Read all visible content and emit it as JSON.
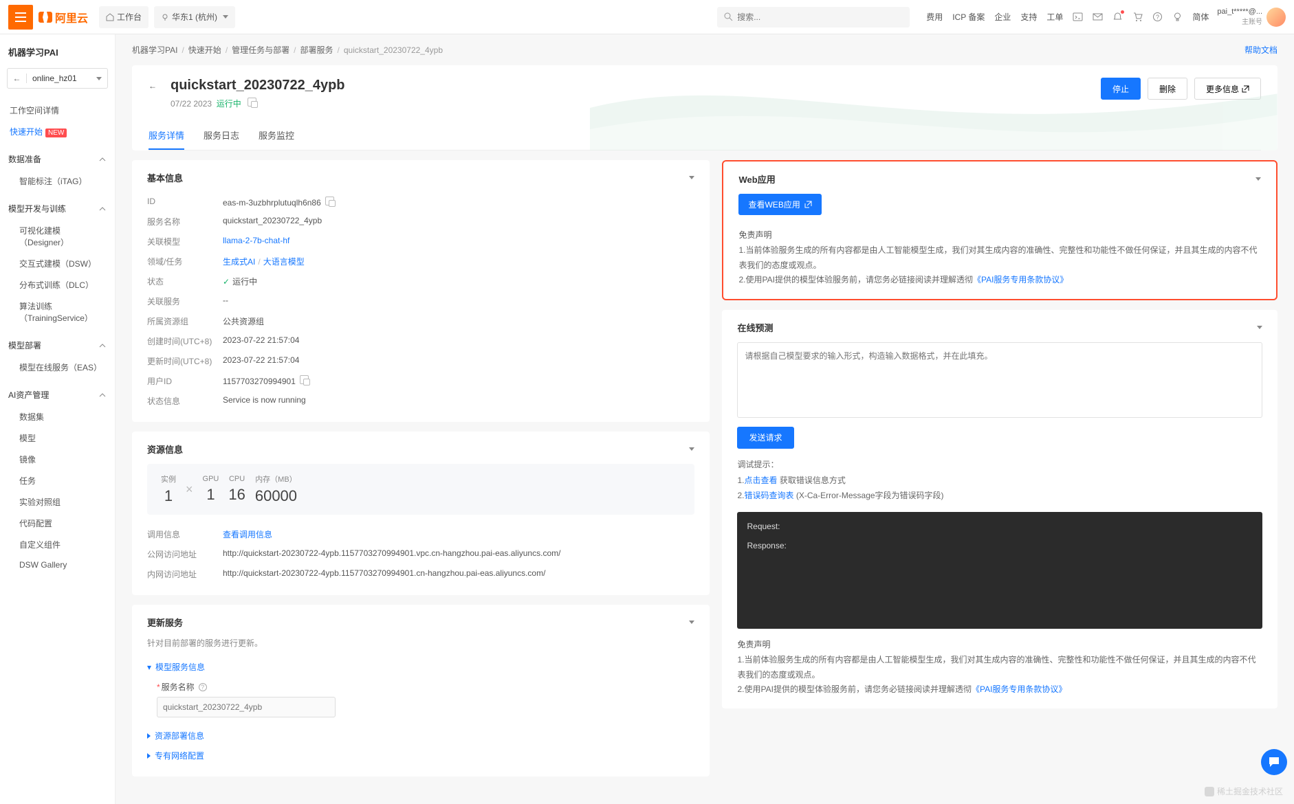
{
  "header": {
    "brand": "阿里云",
    "workspace_btn": "工作台",
    "region": "华东1 (杭州)",
    "search_placeholder": "搜索...",
    "links": [
      "费用",
      "ICP 备案",
      "企业",
      "支持",
      "工单"
    ],
    "lang": "简体",
    "user": "pai_t*****@...",
    "user_sub": "主账号"
  },
  "sidebar": {
    "title": "机器学习PAI",
    "select": "online_hz01",
    "workspace_detail": "工作空间详情",
    "quickstart": "快速开始",
    "quickstart_badge": "NEW",
    "groups": [
      {
        "label": "数据准备",
        "items": [
          "智能标注（iTAG）"
        ]
      },
      {
        "label": "模型开发与训练",
        "items": [
          "可视化建模（Designer）",
          "交互式建模（DSW）",
          "分布式训练（DLC）",
          "算法训练（TrainingService）"
        ]
      },
      {
        "label": "模型部署",
        "items": [
          "模型在线服务（EAS）"
        ]
      },
      {
        "label": "AI资产管理",
        "items": [
          "数据集",
          "模型",
          "镜像",
          "任务",
          "实验对照组",
          "代码配置",
          "自定义组件",
          "DSW Gallery"
        ]
      }
    ]
  },
  "breadcrumb": {
    "items": [
      "机器学习PAI",
      "快速开始",
      "管理任务与部署",
      "部署服务"
    ],
    "current": "quickstart_20230722_4ypb",
    "help": "帮助文档"
  },
  "page": {
    "title": "quickstart_20230722_4ypb",
    "date": "07/22 2023",
    "status": "运行中",
    "actions": {
      "stop": "停止",
      "delete": "删除",
      "more": "更多信息"
    },
    "tabs": [
      "服务详情",
      "服务日志",
      "服务监控"
    ]
  },
  "basic": {
    "heading": "基本信息",
    "rows": {
      "id_k": "ID",
      "id_v": "eas-m-3uzbhrplutuqlh6n86",
      "name_k": "服务名称",
      "name_v": "quickstart_20230722_4ypb",
      "model_k": "关联模型",
      "model_v": "llama-2-7b-chat-hf",
      "domain_k": "领域/任务",
      "domain_a": "生成式AI",
      "domain_b": "大语言模型",
      "state_k": "状态",
      "state_v": "运行中",
      "svc_k": "关联服务",
      "svc_v": "--",
      "resgrp_k": "所属资源组",
      "resgrp_v": "公共资源组",
      "ctime_k": "创建时间(UTC+8)",
      "ctime_v": "2023-07-22 21:57:04",
      "utime_k": "更新时间(UTC+8)",
      "utime_v": "2023-07-22 21:57:04",
      "uid_k": "用户ID",
      "uid_v": "1157703270994901",
      "info_k": "状态信息",
      "info_v": "Service is now running"
    }
  },
  "resource": {
    "heading": "资源信息",
    "inst_l": "实例",
    "inst_v": "1",
    "gpu_l": "GPU",
    "gpu_v": "1",
    "cpu_l": "CPU",
    "cpu_v": "16",
    "mem_l": "内存（MB）",
    "mem_v": "60000",
    "call_k": "调用信息",
    "call_v": "查看调用信息",
    "pub_k": "公网访问地址",
    "pub_v": "http://quickstart-20230722-4ypb.1157703270994901.vpc.cn-hangzhou.pai-eas.aliyuncs.com/",
    "intra_k": "内网访问地址",
    "intra_v": "http://quickstart-20230722-4ypb.1157703270994901.cn-hangzhou.pai-eas.aliyuncs.com/"
  },
  "update": {
    "heading": "更新服务",
    "desc": "针对目前部署的服务进行更新。",
    "sec1": "模型服务信息",
    "svc_name_l": "服务名称",
    "svc_name_ph": "quickstart_20230722_4ypb",
    "sec2": "资源部署信息",
    "sec3": "专有网络配置"
  },
  "webapp": {
    "heading": "Web应用",
    "view_btn": "查看WEB应用",
    "disc_title": "免责声明",
    "d1": "1.当前体验服务生成的所有内容都是由人工智能模型生成，我们对其生成内容的准确性、完整性和功能性不做任何保证，并且其生成的内容不代表我们的态度或观点。",
    "d2_a": "2.使用PAI提供的模型体验服务前，请您务必链接阅读并理解透彻",
    "d2_link": "《PAI服务专用条款协议》"
  },
  "predict": {
    "heading": "在线预测",
    "placeholder": "请根据自己模型要求的输入形式，构造输入数据格式，并在此填充。",
    "send_btn": "发送请求",
    "tips_title": "调试提示：",
    "tip1_a": "1.",
    "tip1_link": "点击查看",
    "tip1_b": " 获取错误信息方式",
    "tip2_a": "2.",
    "tip2_link": "错误码查询表",
    "tip2_b": " (X-Ca-Error-Message字段为错误码字段)",
    "console_req": "Request:",
    "console_res": "Response:",
    "disc2_title": "免责声明",
    "disc2_1": "1.当前体验服务生成的所有内容都是由人工智能模型生成，我们对其生成内容的准确性、完整性和功能性不做任何保证，并且其生成的内容不代表我们的态度或观点。",
    "disc2_2a": "2.使用PAI提供的模型体验服务前，请您务必链接阅读并理解透彻",
    "disc2_2link": "《PAI服务专用条款协议》"
  },
  "watermark": "稀土掘金技术社区"
}
